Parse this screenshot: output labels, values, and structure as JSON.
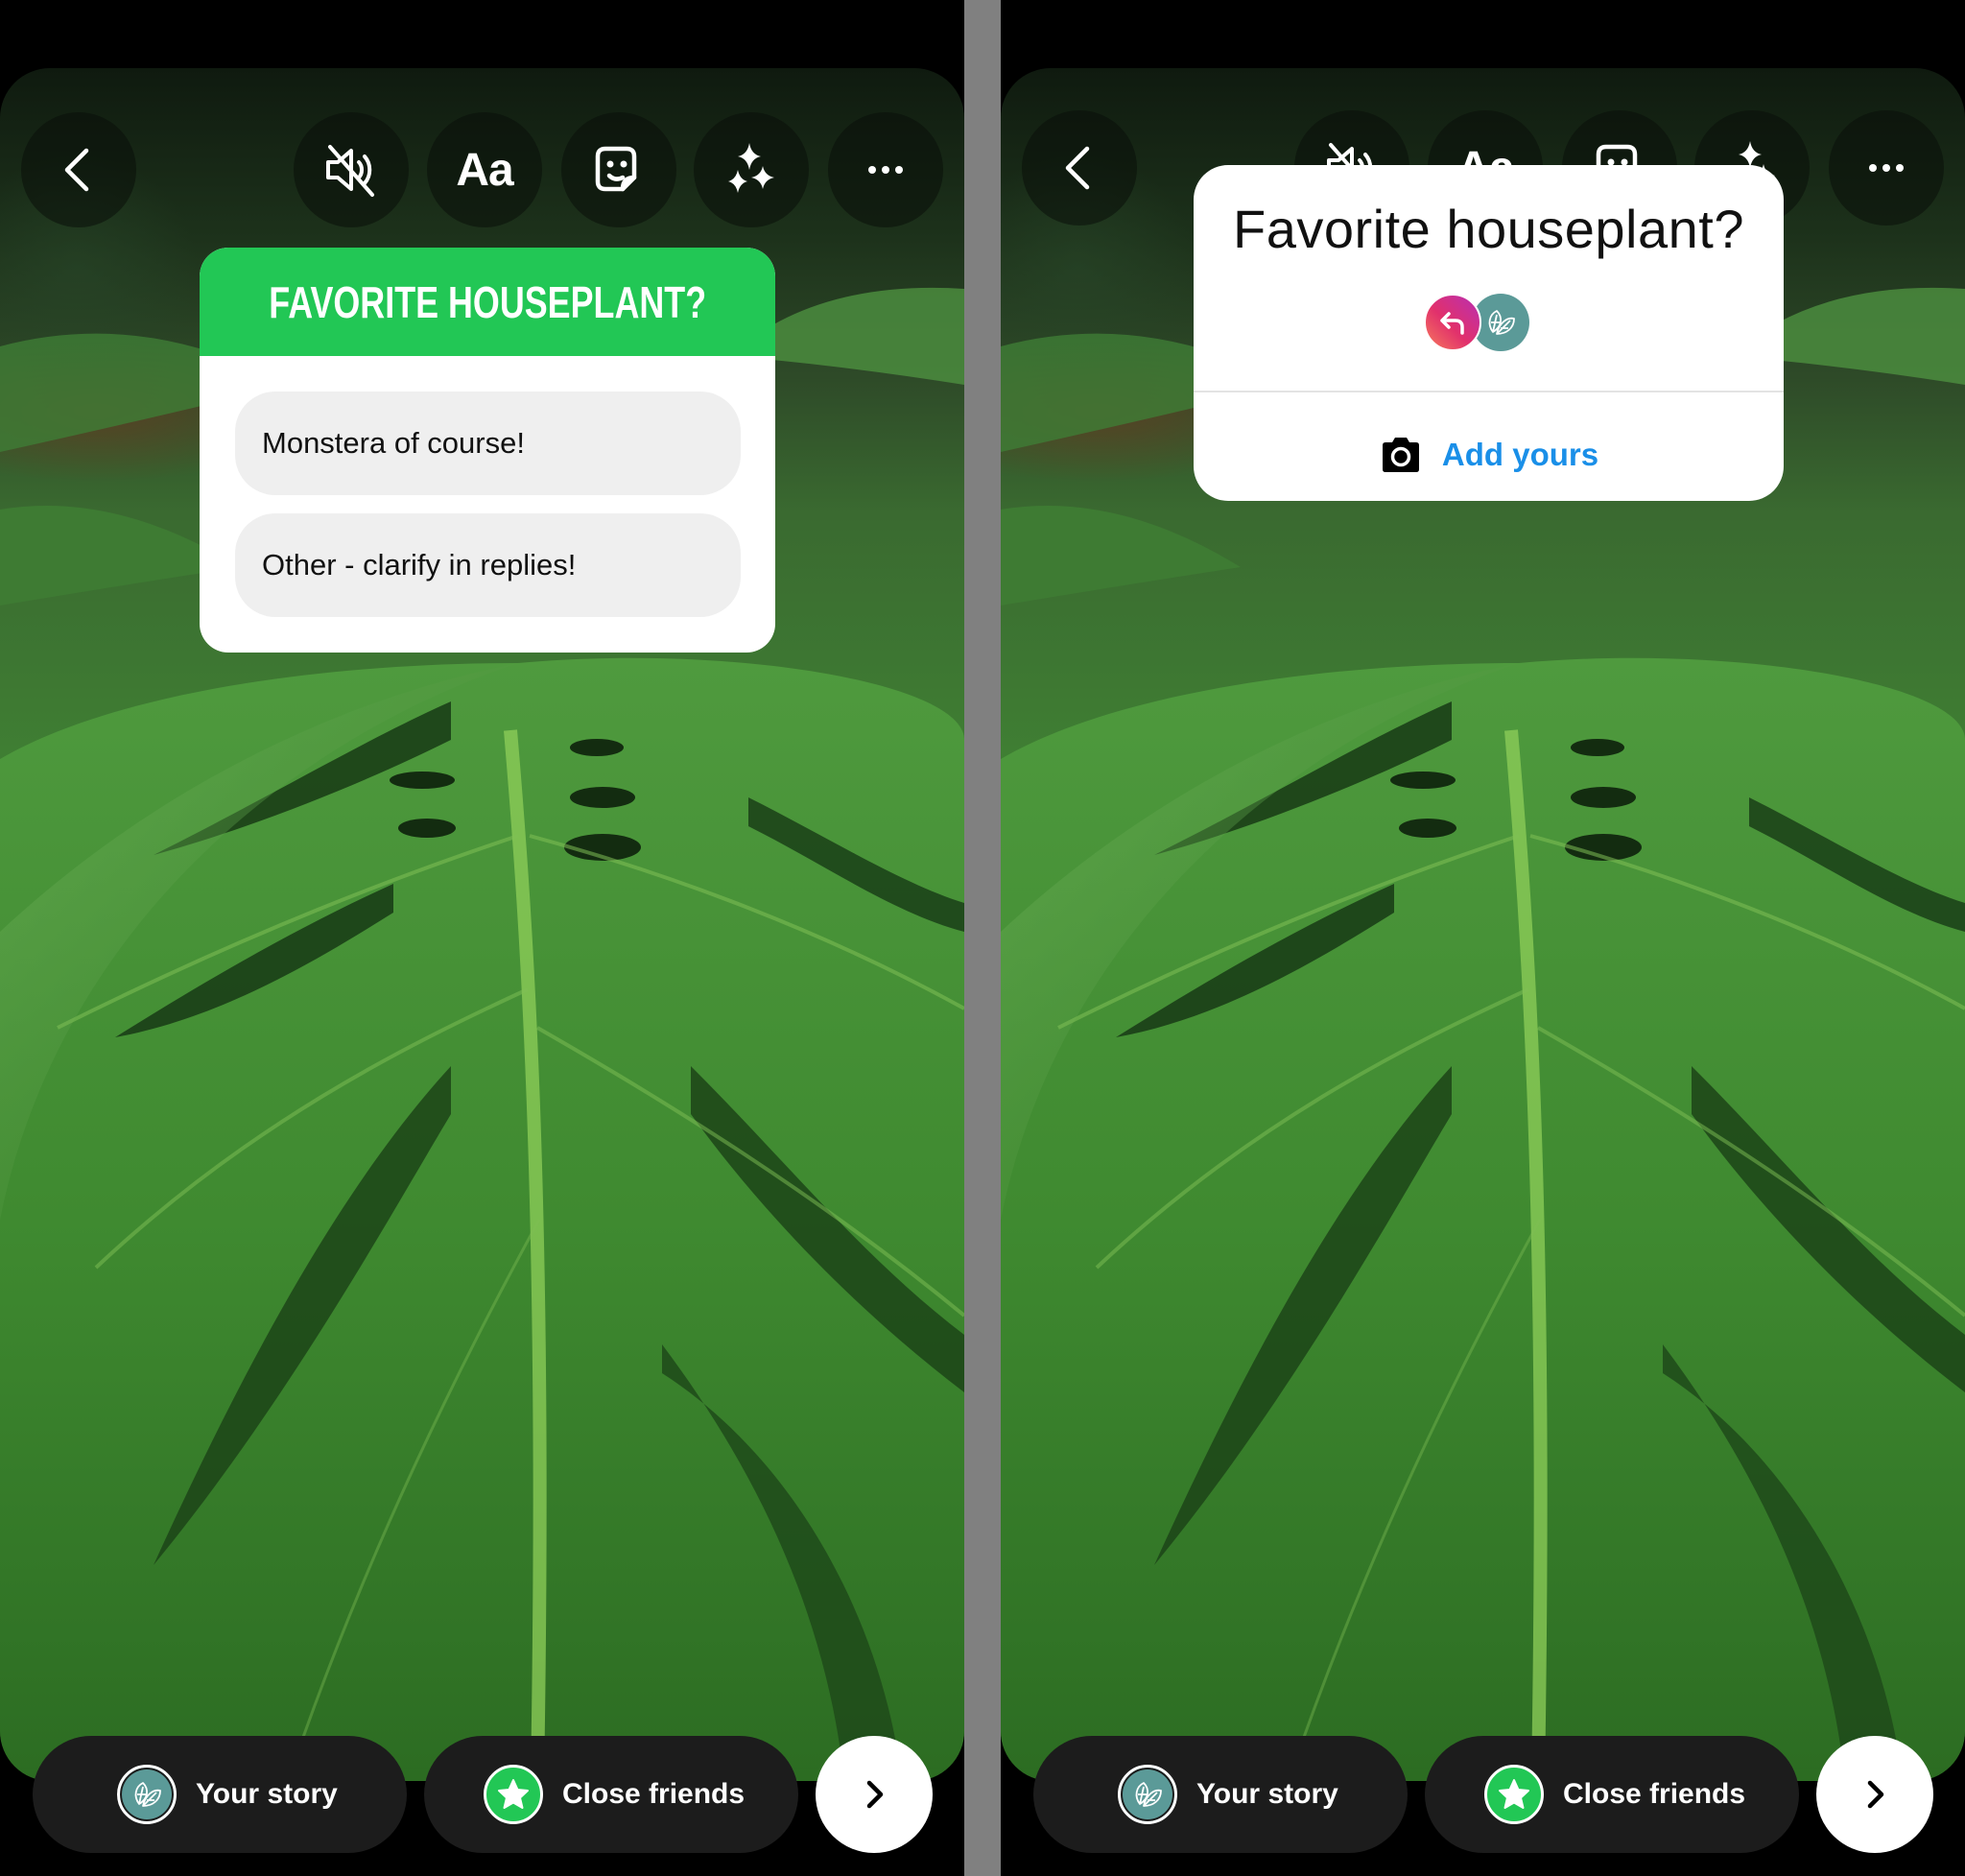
{
  "layout": {
    "divider_color": "#808080"
  },
  "toolbar": {
    "back_icon": "chevron-left-icon",
    "mute_icon": "speaker-muted-icon",
    "text_label": "Aa",
    "sticker_icon": "sticker-smiley-icon",
    "effects_icon": "sparkles-icon",
    "more_icon": "more-horizontal-icon"
  },
  "left_panel": {
    "poll_sticker": {
      "question": "FAVORITE HOUSEPLANT?",
      "header_color": "#22C755",
      "options": [
        {
          "label": "Monstera of course!"
        },
        {
          "label": "Other - clarify in replies!"
        }
      ]
    }
  },
  "right_panel": {
    "add_yours_sticker": {
      "prompt": "Favorite houseplant?",
      "participants": [
        {
          "avatar": "reply-arrow-icon",
          "color": "#E1306C"
        },
        {
          "avatar": "leaf-logo-avatar",
          "color": "#5B9A98"
        }
      ],
      "action_label": "Add yours",
      "action_icon": "camera-icon",
      "action_color": "#1A8FE8"
    }
  },
  "share_bar": {
    "your_story_label": "Your story",
    "close_friends_label": "Close friends",
    "close_friends_color": "#22C755",
    "next_icon": "chevron-right-icon"
  }
}
